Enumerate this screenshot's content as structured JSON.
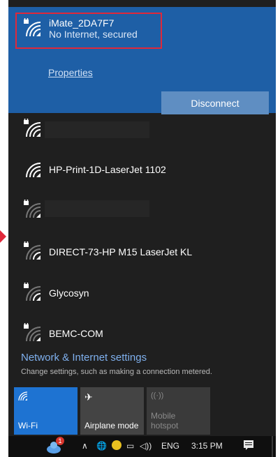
{
  "connected_network": {
    "ssid": "iMate_2DA7F7",
    "status": "No Internet, secured",
    "properties_label": "Properties",
    "disconnect_label": "Disconnect"
  },
  "networks": [
    {
      "name": "",
      "secured": true
    },
    {
      "name": "HP-Print-1D-LaserJet 1102",
      "secured": false
    },
    {
      "name": "",
      "secured": true
    },
    {
      "name": "DIRECT-73-HP M15 LaserJet KL",
      "secured": true
    },
    {
      "name": "Glycosyn",
      "secured": true
    },
    {
      "name": "BEMC-COM",
      "secured": true
    }
  ],
  "settings": {
    "title": "Network & Internet settings",
    "subtitle": "Change settings, such as making a connection metered."
  },
  "quick_actions": [
    {
      "label": "Wi-Fi",
      "icon": "wifi-icon",
      "active": true
    },
    {
      "label": "Airplane mode",
      "icon": "airplane-icon",
      "active": false
    },
    {
      "label": "Mobile\nhotspot",
      "icon": "hotspot-icon",
      "active": false,
      "disabled": true
    }
  ],
  "taskbar": {
    "language": "ENG",
    "time": "3:15 PM",
    "notification_badge": "1"
  },
  "colors": {
    "accent": "#1e5fa6",
    "panel_bg": "#1f1f1f",
    "highlight": "#e0283a",
    "link": "#7fb0ee"
  }
}
